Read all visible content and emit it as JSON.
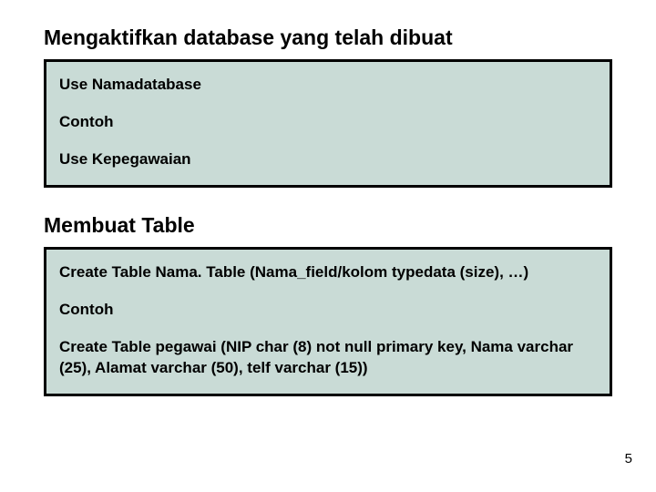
{
  "section1": {
    "heading": "Mengaktifkan database yang telah dibuat",
    "lines": [
      "Use Namadatabase",
      "Contoh",
      "Use Kepegawaian"
    ]
  },
  "section2": {
    "heading": "Membuat Table",
    "lines": [
      "Create Table Nama. Table (Nama_field/kolom typedata (size), …)",
      "Contoh",
      "Create Table pegawai (NIP char (8) not null primary key, Nama varchar (25), Alamat varchar (50), telf varchar (15))"
    ]
  },
  "page_number": "5"
}
